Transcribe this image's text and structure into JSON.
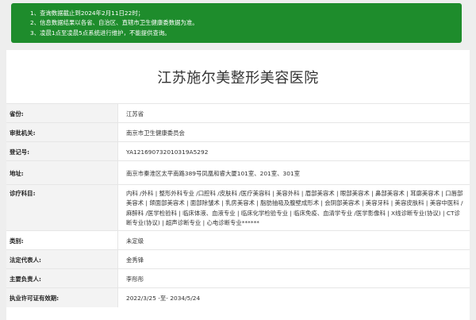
{
  "notice": [
    "1、查询数据截止到2024年2月11日22时；",
    "2、信息数据结果以各省、自治区、直辖市卫生健康委数据为准。",
    "3、凌晨1点至凌晨5点系统进行维护，不能提供查询。"
  ],
  "title": "江苏施尔美整形美容医院",
  "fields": [
    {
      "label": "省份:",
      "value": "江苏省"
    },
    {
      "label": "审批机关:",
      "value": "南京市卫生健康委员会"
    },
    {
      "label": "登记号:",
      "value": "YA121690732010319A5292"
    },
    {
      "label": "地址:",
      "value": "南京市秦淮区太平南路389号凤凰和睿大厦101室、201室、301室"
    },
    {
      "label": "诊疗科目:",
      "value": "内科 /外科 | 整形外科专业 /口腔科 /皮肤科 /医疗美容科 | 美容外科 | 眉部美容术 | 眼部美容术 | 鼻部美容术 | 耳廓美容术 | 口唇部美容术 | 颌面部美容术 | 面部除皱术 | 乳房美容术 | 脂肪抽吸及腹壁成形术 | 会阴部美容术 | 美容牙科 | 美容皮肤科 | 美容中医科 /麻醉科 /医学检验科 | 临床体液、血液专业 | 临床化学检验专业 | 临床免疫、血清学专业 /医学影像科 | X线诊断专业(协议) | CT诊断专业(协议) | 超声诊断专业 | 心电诊断专业******"
    },
    {
      "label": "类别:",
      "value": "未定级"
    },
    {
      "label": "法定代表人:",
      "value": "金秀锋"
    },
    {
      "label": "主要负责人:",
      "value": "李彤彤"
    },
    {
      "label": "执业许可证有效期:",
      "value": "2022/3/25 -至- 2034/5/24"
    }
  ]
}
